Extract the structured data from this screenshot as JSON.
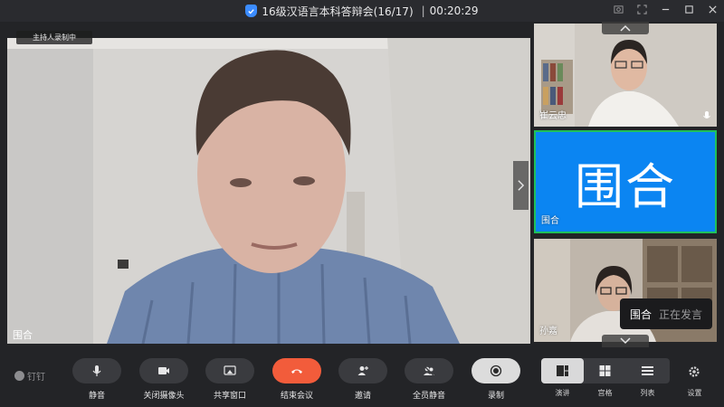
{
  "window": {
    "title": "16级汉语言本科答辩会(16/17)",
    "separator": "|",
    "timer": "00:20:29"
  },
  "main_video": {
    "recording_badge": "主持人录制中",
    "participant_name": "围合"
  },
  "side_panel": {
    "tiles": [
      {
        "name": "崔云忠",
        "type": "video"
      },
      {
        "name": "围合",
        "big_text": "围合",
        "type": "avatar",
        "highlight_color": "#1fc05a",
        "bg_color": "#0b85f2"
      },
      {
        "name": "孙嘉",
        "type": "video"
      }
    ]
  },
  "speaking_tip": {
    "name": "围合",
    "status": "正在发言"
  },
  "toolbar": {
    "brand": "钉钉",
    "buttons": [
      {
        "label": "静音",
        "icon": "mic-icon"
      },
      {
        "label": "关闭摄像头",
        "icon": "camera-icon"
      },
      {
        "label": "共享窗口",
        "icon": "share-screen-icon"
      },
      {
        "label": "结束会议",
        "icon": "hangup-icon"
      },
      {
        "label": "邀请",
        "icon": "invite-icon"
      },
      {
        "label": "全员静音",
        "icon": "mute-all-icon"
      },
      {
        "label": "录制",
        "icon": "record-icon"
      }
    ],
    "views": [
      {
        "label": "演讲",
        "icon": "speaker-view-icon",
        "active": true
      },
      {
        "label": "宫格",
        "icon": "grid-view-icon",
        "active": false
      },
      {
        "label": "列表",
        "icon": "list-view-icon",
        "active": false
      }
    ],
    "settings_label": "设置"
  },
  "colors": {
    "end_call": "#f25c3b",
    "accent_blue": "#0b85f2",
    "speaking_green": "#1fc05a"
  }
}
